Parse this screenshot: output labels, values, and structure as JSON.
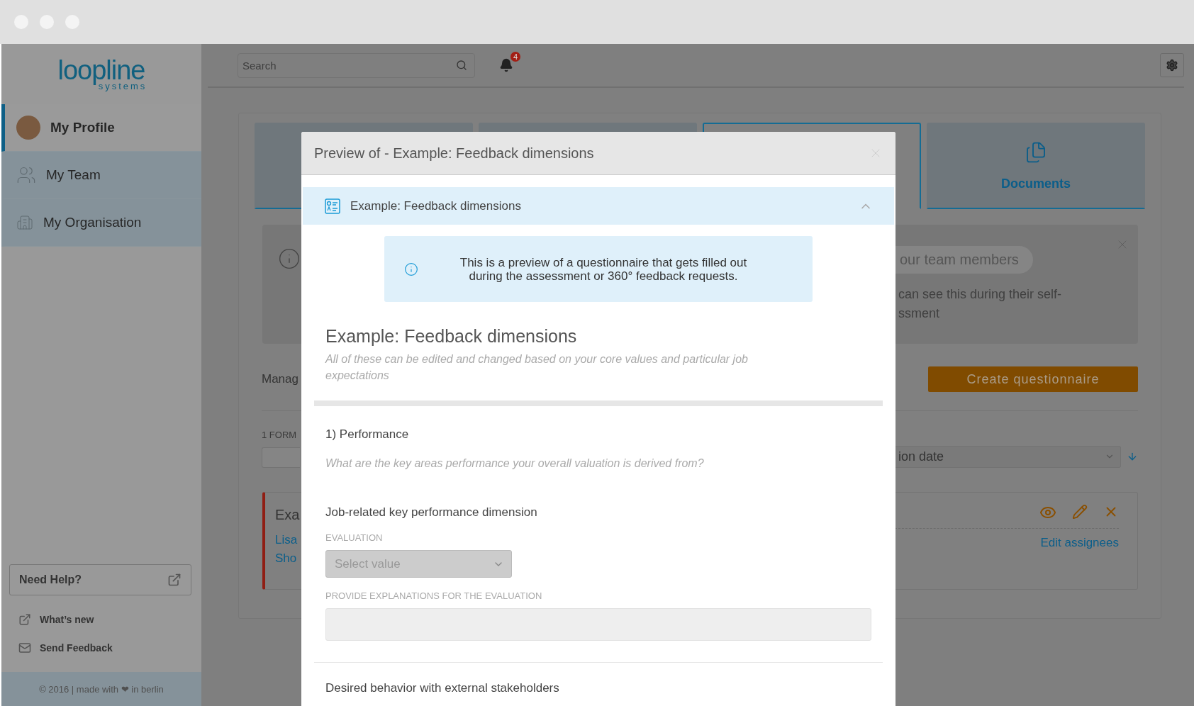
{
  "sidebar": {
    "logo": {
      "name": "loopline",
      "tagline": "systems"
    },
    "nav": [
      {
        "label": "My Profile",
        "selected": true,
        "kind": "avatar"
      },
      {
        "label": "My Team",
        "selected": false,
        "kind": "team"
      },
      {
        "label": "My Organisation",
        "selected": false,
        "kind": "building"
      }
    ],
    "help_button": "Need Help?",
    "links": [
      {
        "label": "What’s new",
        "kind": "external"
      },
      {
        "label": "Send Feedback",
        "kind": "mail"
      }
    ],
    "footer": "© 2016 | made with ❤ in berlin"
  },
  "topbar": {
    "search": {
      "placeholder": "Search"
    },
    "notifications": {
      "count": "4"
    }
  },
  "background": {
    "tabs": [
      {
        "selected": false
      },
      {
        "selected": false
      },
      {
        "selected": true
      },
      {
        "label": "Documents",
        "selected": false
      }
    ],
    "info": {
      "pill": "our team members",
      "text": "can see this during their self-\nssment"
    },
    "section_title": "Manag",
    "create_button": "Create questionnaire",
    "form_count": "1 FORM",
    "sort_select": {
      "value": "ion date"
    },
    "form_card": {
      "title": "Exa",
      "links": [
        "Lisa",
        "Sho"
      ],
      "edit_link": "Edit assignees"
    }
  },
  "dialog": {
    "title": "Preview of - Example: Feedback dimensions",
    "accordion": {
      "title": "Example: Feedback dimensions",
      "expanded": true
    },
    "alert": "This is a preview of a questionnaire that gets filled out during the assessment or 360° feedback requests.",
    "heading": "Example: Feedback dimensions",
    "subtitle": "All of these can be edited and changed based on your core values and particular job expectations",
    "section": {
      "title": "1) Performance",
      "question": "What are the key areas performance your overall valuation is derived from?",
      "items": [
        {
          "title": "Job-related key performance dimension",
          "evaluation_label": "EVALUATION",
          "select": {
            "placeholder": "Select value"
          },
          "explanation_label": "PROVIDE EXPLANATIONS FOR THE EVALUATION"
        },
        {
          "title": "Desired behavior with external stakeholders"
        }
      ]
    }
  }
}
